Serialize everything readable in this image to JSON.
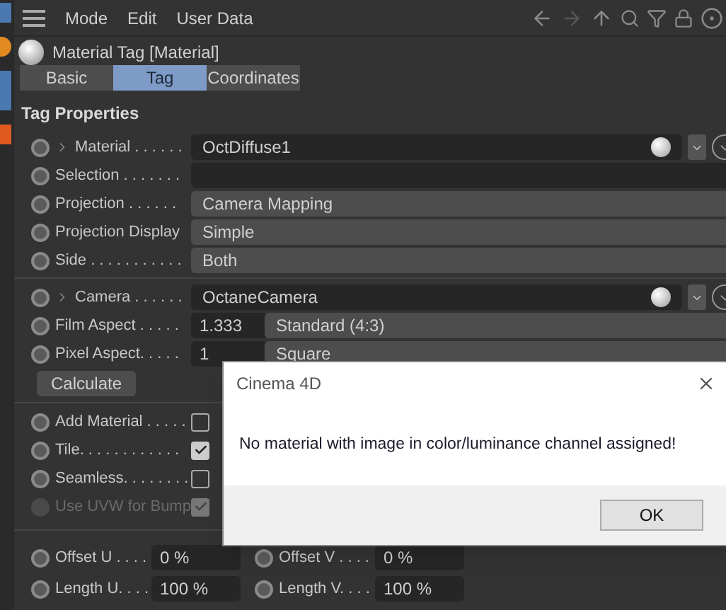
{
  "menu": [
    "Mode",
    "Edit",
    "User Data"
  ],
  "header": {
    "title": "Material Tag [Material]"
  },
  "tabs": [
    {
      "label": "Basic",
      "selected": false
    },
    {
      "label": "Tag",
      "selected": true
    },
    {
      "label": "Coordinates",
      "selected": false
    }
  ],
  "section_title": "Tag Properties",
  "groups": [
    [
      {
        "kind": "link",
        "label": "Material . . . . . .",
        "value": "OctDiffuse1",
        "expanded": false
      },
      {
        "kind": "field",
        "label": "Selection . . . . . . ."
      },
      {
        "kind": "dropdown",
        "label": "Projection . . . . . .",
        "value": "Camera Mapping"
      },
      {
        "kind": "dropdown",
        "label": "Projection Display",
        "value": "Simple"
      },
      {
        "kind": "dropdown",
        "label": "Side . . . . . . . . . . .",
        "value": "Both"
      }
    ],
    [
      {
        "kind": "link",
        "label": "Camera . . . . . .",
        "value": "OctaneCamera",
        "expanded": false
      },
      {
        "kind": "aspect",
        "label": "Film Aspect . . . . .",
        "value": "1.333",
        "option": "Standard (4:3)"
      },
      {
        "kind": "aspect",
        "label": "Pixel Aspect. . . . .",
        "value": "1",
        "option": "Square"
      },
      {
        "kind": "button",
        "label": "Calculate"
      }
    ],
    [
      {
        "kind": "checkbox",
        "label": "Add Material . . . . .",
        "checked": false,
        "disabled": false
      },
      {
        "kind": "checkbox",
        "label": "Tile. . . . . . . . . . . .",
        "checked": true,
        "disabled": false
      },
      {
        "kind": "checkbox",
        "label": "Seamless. . . . . . . .",
        "checked": false,
        "disabled": false
      },
      {
        "kind": "checkbox",
        "label": "Use UVW for Bump",
        "checked": true,
        "disabled": true
      }
    ]
  ],
  "pairs": [
    {
      "left": {
        "label": "Offset U . . . .",
        "value": "0 %"
      },
      "right": {
        "label": "Offset V . . . .",
        "value": "0 %"
      }
    },
    {
      "left": {
        "label": "Length U. . . .",
        "value": "100 %"
      },
      "right": {
        "label": "Length V. . . .",
        "value": "100 %"
      }
    }
  ],
  "dialog": {
    "title": "Cinema 4D",
    "message": "No material with image in color/luminance channel assigned!",
    "button": "OK"
  }
}
